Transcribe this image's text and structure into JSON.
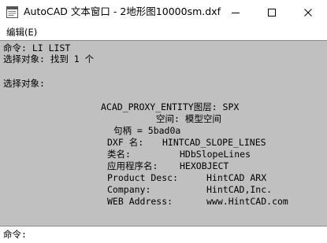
{
  "window": {
    "title": "AutoCAD 文本窗口 - 2地形图10000sm.dxf"
  },
  "menu": {
    "edit_label": "编辑(E)"
  },
  "output": {
    "lines": [
      "命令: LI LIST",
      "选择对象: 找到 1 个",
      "选择对象:",
      "ACAD_PROXY_ENTITY图层: SPX",
      "空间: 模型空间",
      "句柄 = 5bad0a",
      "DXF 名:",
      "HINTCAD_SLOPE_LINES",
      "类名:",
      "HDbSlopeLines",
      "应用程序名:",
      "HEXOBJECT",
      "Product Desc:",
      "HintCAD ARX",
      "Company:",
      "HintCAD,Inc.",
      "WEB Address:",
      "www.HintCAD.com"
    ]
  },
  "command": {
    "prompt": "命令:",
    "value": ""
  },
  "icons": {
    "app": "app-window-icon",
    "minimize": "minimize-icon",
    "maximize": "maximize-icon",
    "close": "close-icon"
  }
}
